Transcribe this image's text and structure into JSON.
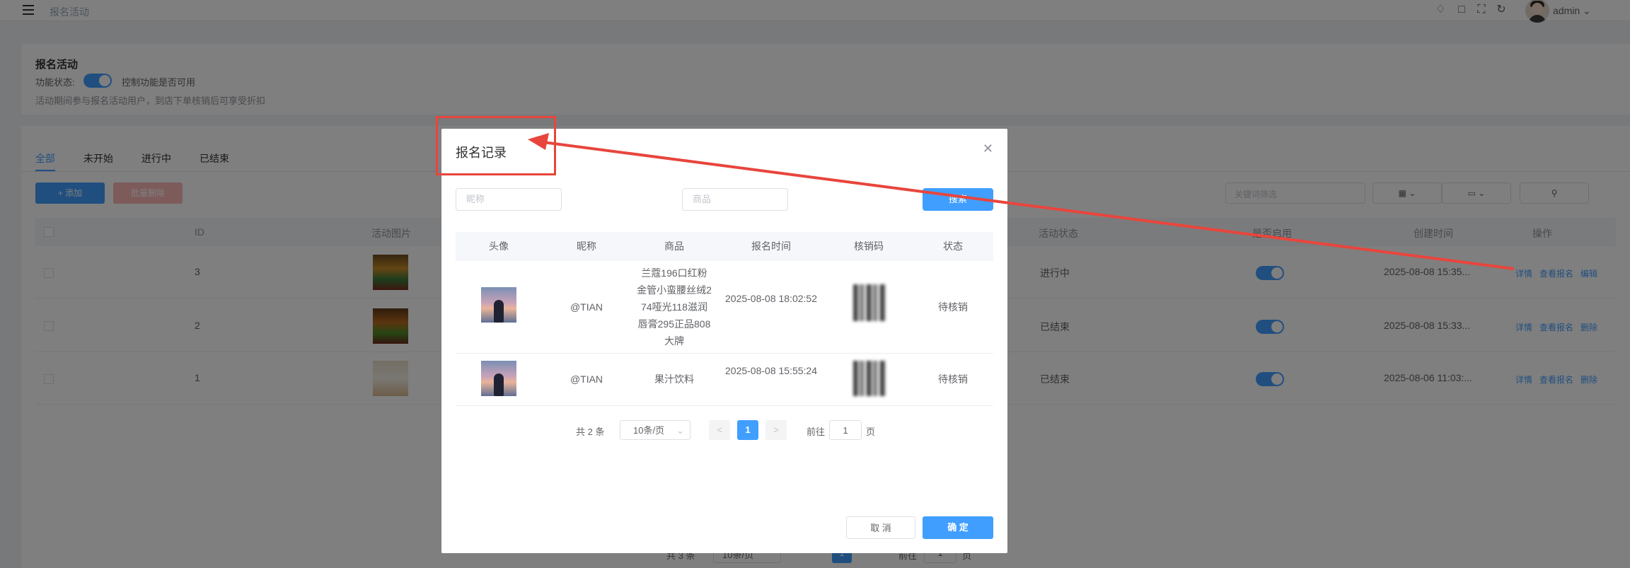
{
  "header": {
    "breadcrumb": "报名活动",
    "username": "admin",
    "icons": [
      "bell-icon",
      "shirt-icon",
      "fullscreen-icon",
      "refresh-icon"
    ]
  },
  "settings": {
    "title": "报名活动",
    "status_label": "功能状态:",
    "status_hint": "控制功能是否可用",
    "description": "活动期间参与报名活动用户，到店下单核销后可享受折扣"
  },
  "tabs": [
    "全部",
    "未开始",
    "进行中",
    "已结束"
  ],
  "toolbar": {
    "add": "添加",
    "batch_delete": "批量删除",
    "keyword_placeholder": "关键词筛选"
  },
  "table": {
    "headers": [
      "ID",
      "活动图片",
      "活动状态",
      "是否启用",
      "创建时间",
      "操作"
    ],
    "rows": [
      {
        "id": "3",
        "status": "进行中",
        "created": "2025-08-08 15:35...",
        "actions": [
          "详情",
          "查看报名",
          "编辑"
        ]
      },
      {
        "id": "2",
        "status": "已结束",
        "created": "2025-08-08 15:33...",
        "actions": [
          "详情",
          "查看报名",
          "删除"
        ]
      },
      {
        "id": "1",
        "status": "已结束",
        "created": "2025-08-06 11:03:...",
        "actions": [
          "详情",
          "查看报名",
          "删除"
        ]
      }
    ],
    "pagination": {
      "total": "共 3 条",
      "page_size": "10条/页",
      "page": "1",
      "goto": "前往",
      "goto_value": "1",
      "page_suffix": "页"
    }
  },
  "dialog": {
    "title": "报名记录",
    "nickname_placeholder": "昵称",
    "product_placeholder": "商品",
    "search_label": "搜索",
    "headers": [
      "头像",
      "昵称",
      "商品",
      "报名时间",
      "核销码",
      "状态"
    ],
    "rows": [
      {
        "nickname": "@TIAN",
        "product": "兰蔻196口红粉金管小蛮腰丝绒274哑光118滋润唇膏295正品808大牌",
        "time": "2025-08-08 18:02:52",
        "status": "待核销"
      },
      {
        "nickname": "@TIAN",
        "product": "果汁饮料",
        "time": "2025-08-08 15:55:24",
        "status": "待核销"
      }
    ],
    "pagination": {
      "total": "共 2 条",
      "page_size": "10条/页",
      "page": "1",
      "goto": "前往",
      "goto_value": "1",
      "page_suffix": "页"
    },
    "cancel": "取 消",
    "confirm": "确 定"
  },
  "colors": {
    "primary": "#409eff",
    "danger": "#f56c6c",
    "annotation": "#e8453c"
  }
}
